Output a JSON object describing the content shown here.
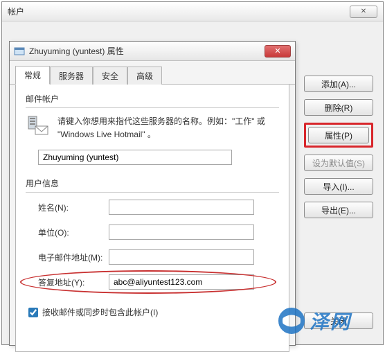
{
  "parent": {
    "title": "帐户",
    "close_glyph": "✕"
  },
  "buttons": {
    "add": "添加(A)...",
    "delete": "删除(R)",
    "properties": "属性(P)",
    "set_default": "设为默认值(S)",
    "import": "导入(I)...",
    "export": "导出(E)...",
    "close": "关闭"
  },
  "dialog": {
    "title": "Zhuyuming (yuntest) 属性",
    "close_glyph": "✕",
    "tabs": [
      "常规",
      "服务器",
      "安全",
      "高级"
    ],
    "section_account": "邮件帐户",
    "account_hint": "请键入你想用来指代这些服务器的名称。例如：\"工作\" 或 \"Windows Live Hotmail\" 。",
    "account_name": "Zhuyuming (yuntest)",
    "section_user": "用户信息",
    "labels": {
      "name": "姓名(N):",
      "org": "单位(O):",
      "email": "电子邮件地址(M):",
      "reply": "答复地址(Y):"
    },
    "values": {
      "name": "",
      "org": "",
      "email": "",
      "reply": "abc@aliyuntest123.com"
    },
    "checkbox_label": "接收邮件或同步时包含此帐户(I)",
    "checkbox_checked": true
  },
  "watermark": "泽网"
}
